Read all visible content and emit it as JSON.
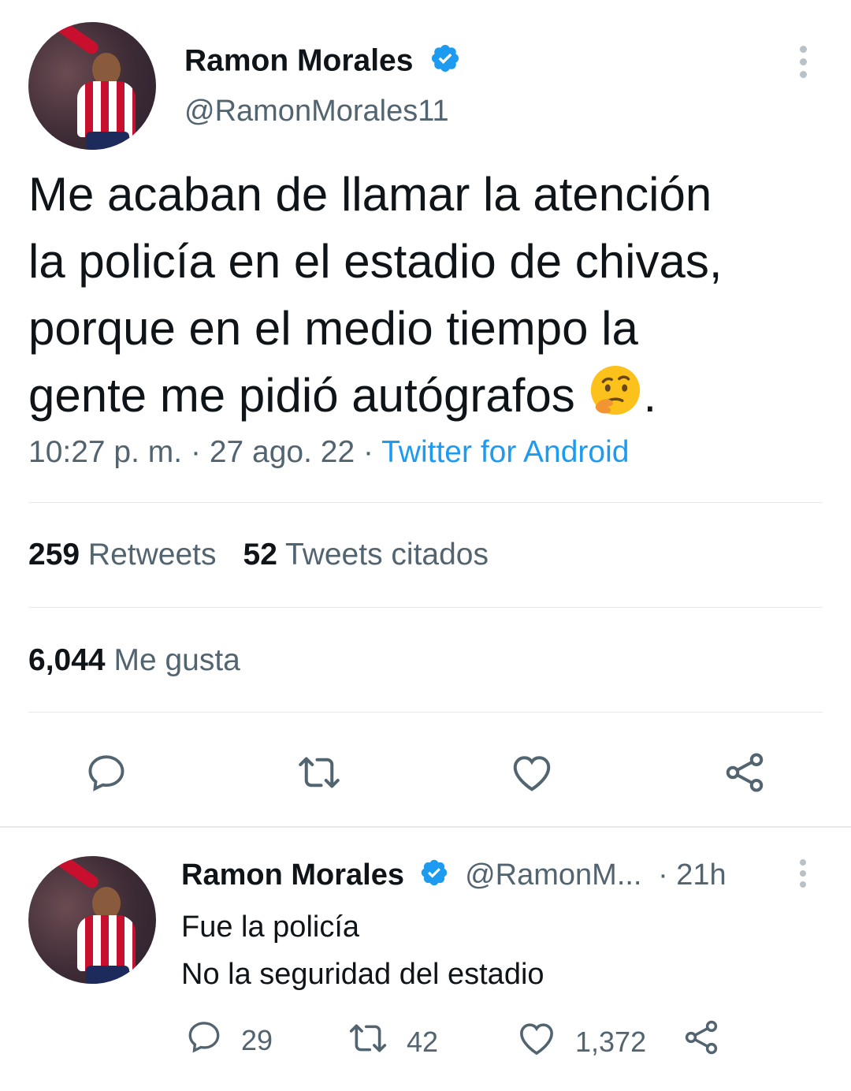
{
  "tweet": {
    "author_name": "Ramon Morales",
    "author_handle": "@RamonMorales11",
    "text_line1": "Me acaban de llamar la atención",
    "text_line2": "la policía en el estadio de chivas,",
    "text_line3": "porque en el medio tiempo la",
    "text_line4": "gente me pidió autógrafos",
    "text_end": ".",
    "time": "10:27 p. m.",
    "date": "27 ago. 22",
    "separator": "·",
    "source": "Twitter for Android",
    "retweets_count": "259",
    "retweets_label": "Retweets",
    "quotes_count": "52",
    "quotes_label": "Tweets citados",
    "likes_count": "6,044",
    "likes_label": "Me gusta"
  },
  "reply": {
    "author_name": "Ramon Morales",
    "author_handle": "@RamonM...",
    "time": "· 21h",
    "line1": "Fue la policía",
    "line2": "No la seguridad del estadio",
    "replies": "29",
    "retweets": "42",
    "likes": "1,372"
  },
  "colors": {
    "verified": "#1d9bf0",
    "link": "#1d9bf0",
    "secondary_text": "#536471",
    "icon": "#536471"
  },
  "icons": [
    "verified-badge-icon",
    "more-icon",
    "reply-icon",
    "retweet-icon",
    "like-icon",
    "share-icon",
    "thinking-face-emoji"
  ]
}
